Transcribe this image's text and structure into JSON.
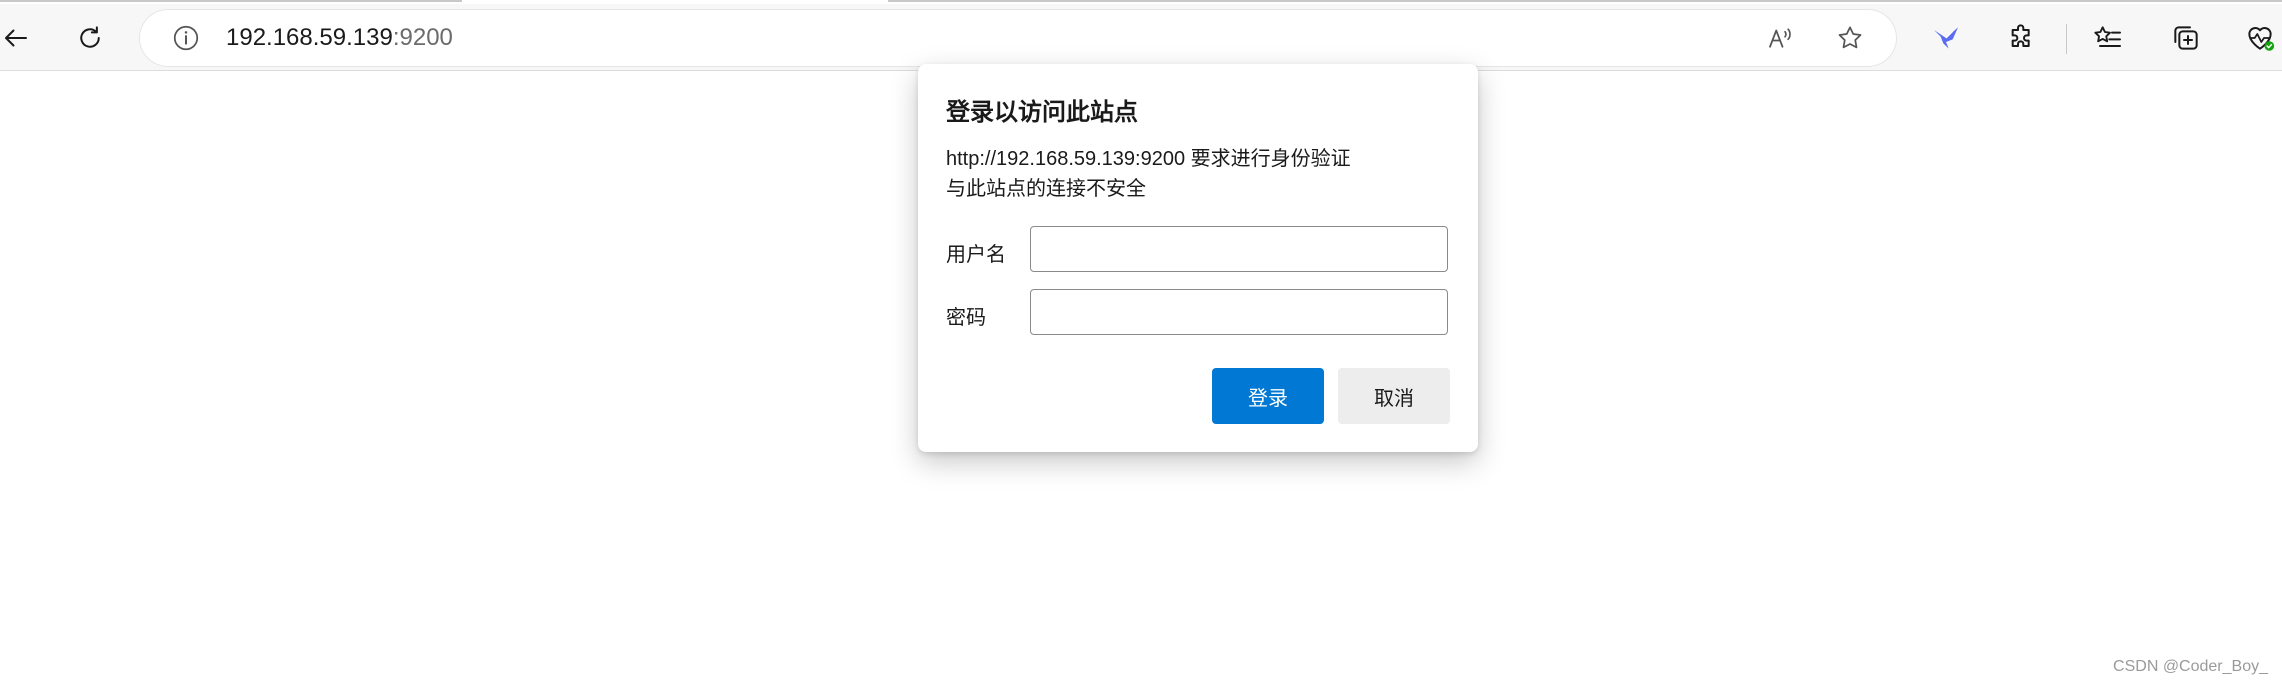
{
  "browser": {
    "address": {
      "host": "192.168.59.139",
      "port": ":9200"
    },
    "icons": {
      "back": "back-arrow-icon",
      "refresh": "refresh-icon",
      "site_info": "info-icon",
      "read_aloud": "read-aloud-icon",
      "favorite": "star-icon",
      "extension_app": "bird-extension-icon",
      "extensions": "puzzle-icon",
      "favorites_list": "favorites-list-icon",
      "collections": "collections-icon",
      "performance": "heartbeat-icon"
    },
    "accent_color": "#0078d4"
  },
  "auth_dialog": {
    "title": "登录以访问此站点",
    "message_line1": "http://192.168.59.139:9200 要求进行身份验证",
    "message_line2": "与此站点的连接不安全",
    "username_label": "用户名",
    "username_value": "",
    "password_label": "密码",
    "password_value": "",
    "login_button": "登录",
    "cancel_button": "取消"
  },
  "watermark": "CSDN @Coder_Boy_"
}
